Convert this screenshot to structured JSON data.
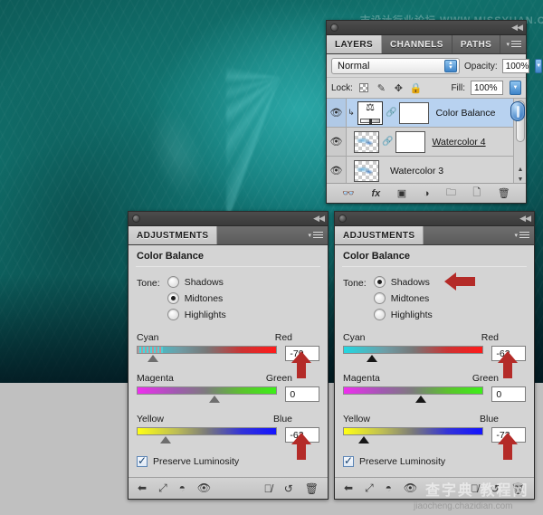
{
  "artwork": {
    "name": "teal-watercolor-artwork"
  },
  "watermarks": {
    "top": "志设计行业论坛 WWW.MISSYUAN.COM",
    "middle": "查字典 教程网",
    "bottom": "jiaocheng.chazidian.com"
  },
  "layers_panel": {
    "tabs": [
      {
        "label": "LAYERS",
        "active": true
      },
      {
        "label": "CHANNELS",
        "active": false
      },
      {
        "label": "PATHS",
        "active": false
      }
    ],
    "blend_mode": "Normal",
    "opacity_label": "Opacity:",
    "opacity_value": "100%",
    "lock_label": "Lock:",
    "fill_label": "Fill:",
    "fill_value": "100%",
    "lock_icons": [
      "transparency-lock-icon",
      "brush-lock-icon",
      "move-lock-icon",
      "lock-all-icon"
    ],
    "layers": [
      {
        "name": "Color Balance",
        "selected": true,
        "kind": "adjustment",
        "clipped": true,
        "linked": true,
        "has_mask": true
      },
      {
        "name": "Watercolor 4",
        "selected": false,
        "kind": "pixel",
        "clipped": false,
        "linked": true,
        "has_mask": true
      },
      {
        "name": "Watercolor 3",
        "selected": false,
        "kind": "pixel",
        "clipped": false,
        "linked": false,
        "has_mask": false
      }
    ],
    "footer_icons": [
      "link-layers-icon",
      "layer-style-fx-icon",
      "add-mask-icon",
      "new-fill-adjustment-icon",
      "new-group-icon",
      "new-layer-icon",
      "delete-layer-icon"
    ]
  },
  "adjustments_left": {
    "tab_label": "ADJUSTMENTS",
    "title": "Color Balance",
    "tone_label": "Tone:",
    "tone_options": [
      {
        "label": "Shadows",
        "selected": false
      },
      {
        "label": "Midtones",
        "selected": true
      },
      {
        "label": "Highlights",
        "selected": false
      }
    ],
    "sliders": [
      {
        "left_label": "Cyan",
        "right_label": "Red",
        "value": "-79",
        "thumb_pct": 10.5,
        "arrow": true
      },
      {
        "left_label": "Magenta",
        "right_label": "Green",
        "value": "0",
        "thumb_pct": 50.0,
        "arrow": false
      },
      {
        "left_label": "Yellow",
        "right_label": "Blue",
        "value": "-62",
        "thumb_pct": 19.0,
        "arrow": true
      }
    ],
    "preserve_luminosity": "Preserve Luminosity",
    "footer_icons": [
      "back-to-list-icon",
      "expand-view-icon",
      "clip-to-layer-icon",
      "toggle-visibility-icon",
      "preview-previous-icon",
      "reset-icon",
      "delete-adjustment-icon"
    ]
  },
  "adjustments_right": {
    "tab_label": "ADJUSTMENTS",
    "title": "Color Balance",
    "tone_label": "Tone:",
    "tone_options": [
      {
        "label": "Shadows",
        "selected": true,
        "arrow": true
      },
      {
        "label": "Midtones",
        "selected": false,
        "arrow": false
      },
      {
        "label": "Highlights",
        "selected": false,
        "arrow": false
      }
    ],
    "sliders": [
      {
        "left_label": "Cyan",
        "right_label": "Red",
        "value": "-62",
        "thumb_pct": 19.0,
        "arrow": true
      },
      {
        "left_label": "Magenta",
        "right_label": "Green",
        "value": "0",
        "thumb_pct": 50.0,
        "arrow": false
      },
      {
        "left_label": "Yellow",
        "right_label": "Blue",
        "value": "-73",
        "thumb_pct": 13.5,
        "arrow": true
      }
    ],
    "preserve_luminosity": "Preserve Luminosity",
    "footer_icons": [
      "back-to-list-icon",
      "expand-view-icon",
      "clip-to-layer-icon",
      "toggle-visibility-icon",
      "preview-previous-icon",
      "reset-icon",
      "delete-adjustment-icon"
    ]
  },
  "colors": {
    "panel_bg": "#d4d4d4",
    "selection_blue": "#b8d2f0",
    "arrow_red": "#b42b28",
    "artwork_teal": "#11716c"
  }
}
